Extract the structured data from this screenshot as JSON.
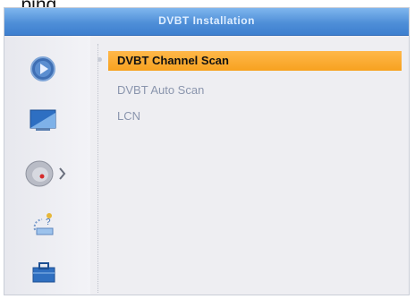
{
  "caption": "...ping...",
  "window": {
    "title": "DVBT Installation"
  },
  "sidebar": {
    "icons": [
      {
        "name": "play-icon"
      },
      {
        "name": "picture-icon"
      },
      {
        "name": "satellite-dish-icon",
        "selected": true
      },
      {
        "name": "network-icon"
      },
      {
        "name": "toolbox-icon"
      }
    ]
  },
  "menu": {
    "items": [
      {
        "label": "DVBT Channel Scan",
        "selected": true
      },
      {
        "label": "DVBT Auto Scan",
        "selected": false
      },
      {
        "label": "LCN",
        "selected": false
      }
    ]
  },
  "colors": {
    "title_bar": "#4f8fd8",
    "highlight": "#f7a21f",
    "menu_text": "#8a95ad"
  }
}
